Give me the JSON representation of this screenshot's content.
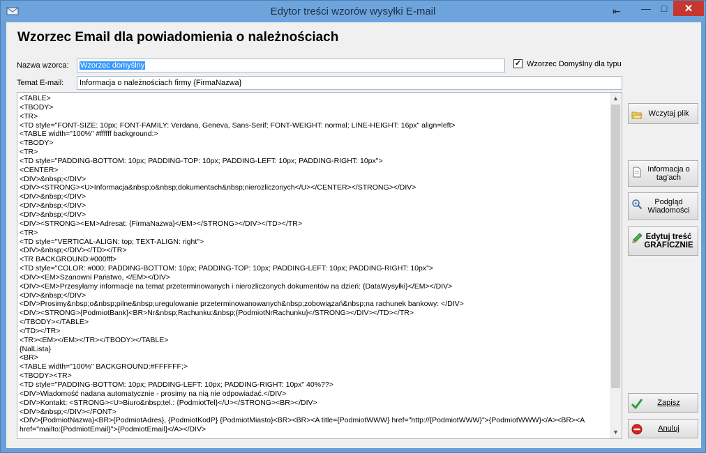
{
  "window": {
    "title": "Edytor treści wzorów wysyłki E-mail",
    "close_glyph": "✕",
    "min_glyph": "—",
    "max_glyph": "□",
    "extra_glyph": "⇤"
  },
  "heading": "Wzorzec Email dla powiadomienia o należnościach",
  "form": {
    "name_label": "Nazwa wzorca:",
    "name_value": "Wzorzec domyślny",
    "default_checkbox_label": "Wzorzec Domyślny dla typu",
    "default_checked": true,
    "subject_label": "Temat E-mail:",
    "subject_value": "Informacja o należnościach firmy {FirmaNazwa}"
  },
  "editor": {
    "lines": [
      "<TABLE>",
      "<TBODY>",
      "<TR>",
      "<TD style=\"FONT-SIZE: 10px; FONT-FAMILY: Verdana, Geneva, Sans-Serif; FONT-WEIGHT: normal; LINE-HEIGHT: 16px\" align=left>",
      "<TABLE width=\"100%\" #ffffff background:>",
      "<TBODY>",
      "<TR>",
      "<TD style=\"PADDING-BOTTOM: 10px; PADDING-TOP: 10px; PADDING-LEFT: 10px; PADDING-RIGHT: 10px\">",
      "<CENTER>",
      "<DIV>&nbsp;</DIV>",
      "<DIV><STRONG><U>Informacja&nbsp;o&nbsp;dokumentach&nbsp;nierozliczonych</U></CENTER></STRONG></DIV>",
      "<DIV>&nbsp;</DIV>",
      "<DIV>&nbsp;</DIV>",
      "<DIV>&nbsp;</DIV>",
      "<DIV><STRONG><EM>Adresat: {FirmaNazwa}</EM></STRONG></DIV></TD></TR>",
      "<TR>",
      "<TD style=\"VERTICAL-ALIGN: top; TEXT-ALIGN: right\">",
      "<DIV>&nbsp;</DIV></TD></TR>",
      "<TR BACKGROUND:#000fff>",
      "<TD style=\"COLOR: #000; PADDING-BOTTOM: 10px; PADDING-TOP: 10px; PADDING-LEFT: 10px; PADDING-RIGHT: 10px\">",
      "<DIV><EM>Szanowni Państwo, </EM></DIV>",
      "<DIV><EM>Przesyłamy informacje na temat przeterminowanych i nierozliczonych dokumentów na dzień: {DataWysyłki}</EM></DIV>",
      "<DIV>&nbsp;</DIV>",
      "<DIV>Prosimy&nbsp;o&nbsp;pilne&nbsp;uregulowanie przeterminowanowanych&nbsp;zobowiązań&nbsp;na rachunek bankowy: </DIV>",
      "<DIV><STRONG>{PodmiotBank}<BR>Nr&nbsp;Rachunku:&nbsp;{PodmiotNrRachunku}</STRONG></DIV></TD></TR>",
      "</TBODY></TABLE>",
      "</TD></TR>",
      "<TR><EM></EM></TR></TBODY></TABLE>",
      "{NalLista}",
      "<BR>",
      "<TABLE width=\"100%\" BACKGROUND:#FFFFFF;>",
      "<TBODY><TR>",
      "<TD style=\"PADDING-BOTTOM: 10px; PADDING-LEFT: 10px; PADDING-RIGHT: 10px\" 40%??>",
      "<DIV>Wiadomość nadana automatycznie - prosimy na nią nie odpowiadać.</DIV>",
      "<DIV>Kontakt: <STRONG><U>Biuro&nbsp;tel.: {PodmiotTel}</U></STRONG><BR></DIV>",
      "<DIV>&nbsp;</DIV></FONT>",
      "<DIV>{PodmiotNazwa}<BR>{PodmiotAdres}, {PodmiotKodP} {PodmiotMiasto}<BR><BR><A title={PodmiotWWW} href=\"http://{PodmiotWWW}\">{PodmiotWWW}</A><BR><A",
      "href=\"mailto:{PodmiotEmail}\">{PodmiotEmail}</A></DIV>"
    ]
  },
  "buttons": {
    "load": "Wczytaj plik",
    "info": "Informacja o tag'ach",
    "preview": "Podgląd Wiadomości",
    "edit_line1": "Edytuj treść",
    "edit_line2": "GRAFICZNIE",
    "save": "Zapisz",
    "cancel": "Anuluj"
  },
  "icons": {
    "app": "mail-app-icon",
    "load": "folder-open-icon",
    "info": "document-icon",
    "preview": "magnifier-icon",
    "edit": "pencil-icon",
    "save": "checkmark-icon",
    "cancel": "no-entry-icon"
  }
}
